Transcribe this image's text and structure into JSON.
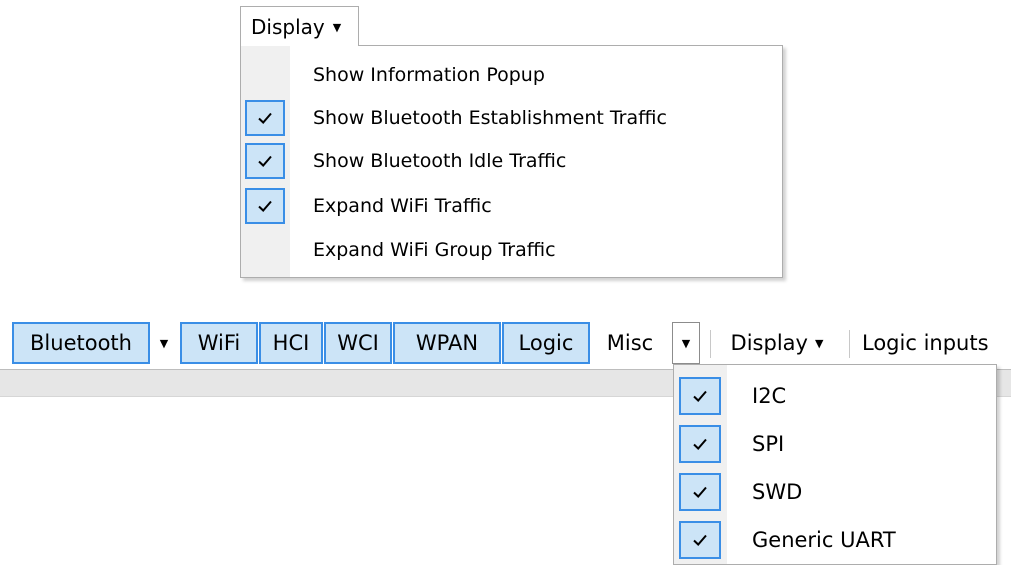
{
  "display_menu": {
    "button_label": "Display",
    "items": [
      {
        "label": "Show Information Popup",
        "checked": false
      },
      {
        "label": "Show Bluetooth Establishment Traffic",
        "checked": true
      },
      {
        "label": "Show Bluetooth Idle Traffic",
        "checked": true
      },
      {
        "label": "Expand WiFi Traffic",
        "checked": true
      },
      {
        "label": "Expand WiFi Group Traffic",
        "checked": false
      }
    ]
  },
  "toolbar": {
    "bluetooth": "Bluetooth",
    "wifi": "WiFi",
    "hci": "HCI",
    "wci": "WCI",
    "wpan": "WPAN",
    "logic": "Logic",
    "misc": "Misc",
    "display": "Display",
    "logic_inputs": "Logic inputs"
  },
  "misc_menu": {
    "items": [
      {
        "label": "I2C",
        "checked": true
      },
      {
        "label": "SPI",
        "checked": true
      },
      {
        "label": "SWD",
        "checked": true
      },
      {
        "label": "Generic UART",
        "checked": true
      }
    ]
  },
  "colors": {
    "checked_fill": "#cce4f7",
    "checked_border": "#3a8ee6",
    "menu_gutter": "#f0f0f0"
  },
  "icons": {
    "check": "checkmark-icon",
    "dropdown": "chevron-down-icon"
  }
}
